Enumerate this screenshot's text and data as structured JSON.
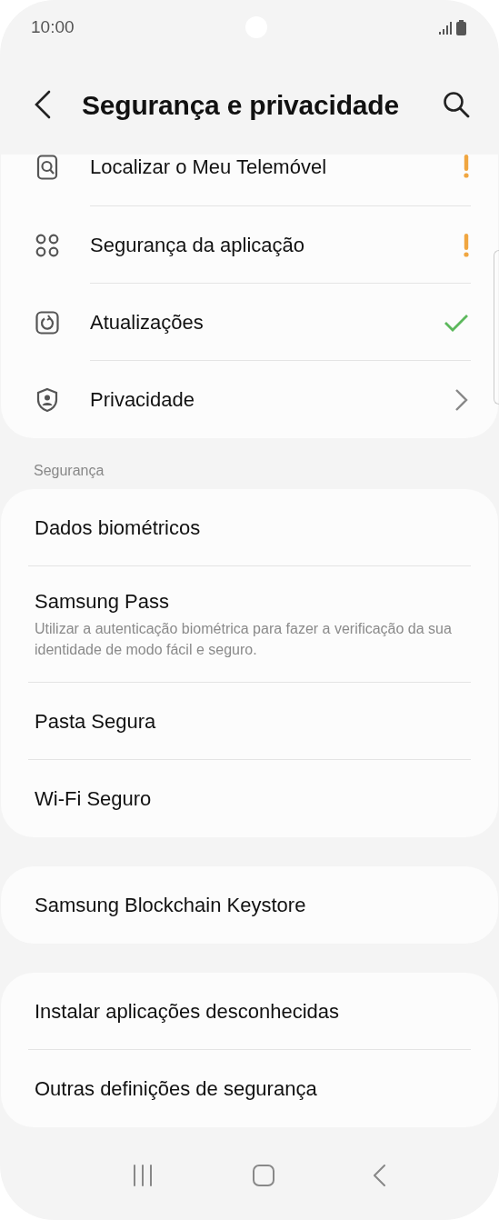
{
  "status_bar": {
    "time": "10:00"
  },
  "header": {
    "title": "Segurança e privacidade"
  },
  "groups": [
    {
      "cut_top": true,
      "items": [
        {
          "label": "Localizar o Meu Telemóvel",
          "kind": "warning"
        },
        {
          "label": "Segurança da aplicação",
          "kind": "warning"
        },
        {
          "label": "Atualizações",
          "kind": "check"
        },
        {
          "label": "Privacidade",
          "kind": "chevron"
        }
      ]
    },
    {
      "heading": "Segurança",
      "items": [
        {
          "label": "Dados biométricos"
        },
        {
          "label": "Samsung Pass",
          "description": "Utilizar a autenticação biométrica para fazer a verificação da sua identidade de modo fácil e seguro."
        },
        {
          "label": "Pasta Segura"
        },
        {
          "label": "Wi-Fi Seguro"
        }
      ]
    },
    {
      "items": [
        {
          "label": "Samsung Blockchain Keystore"
        }
      ]
    },
    {
      "items": [
        {
          "label": "Instalar aplicações desconhecidas"
        },
        {
          "label": "Outras definições de segurança"
        }
      ]
    }
  ]
}
